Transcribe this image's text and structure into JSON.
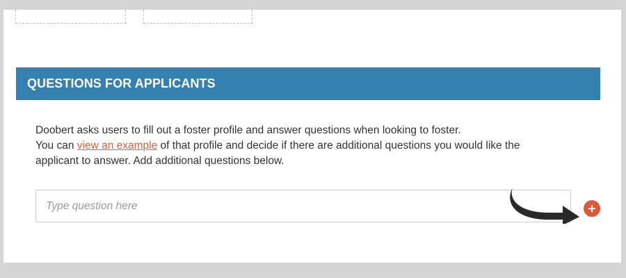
{
  "section": {
    "title": "QUESTIONS FOR APPLICANTS"
  },
  "description": {
    "line1": "Doobert asks users to fill out a foster profile and answer questions when looking to foster.",
    "line2_before": "You can ",
    "link": "view an example",
    "line2_after": " of that profile and decide if there are additional questions you would like the",
    "line3": "applicant to answer. Add additional questions below."
  },
  "question_input": {
    "value": "",
    "placeholder": "Type question here"
  },
  "icons": {
    "add": "plus-icon",
    "pointer": "curved-arrow-icon"
  },
  "colors": {
    "header_bg": "#3480ae",
    "link": "#d8623c",
    "add_button": "#df5a34"
  }
}
